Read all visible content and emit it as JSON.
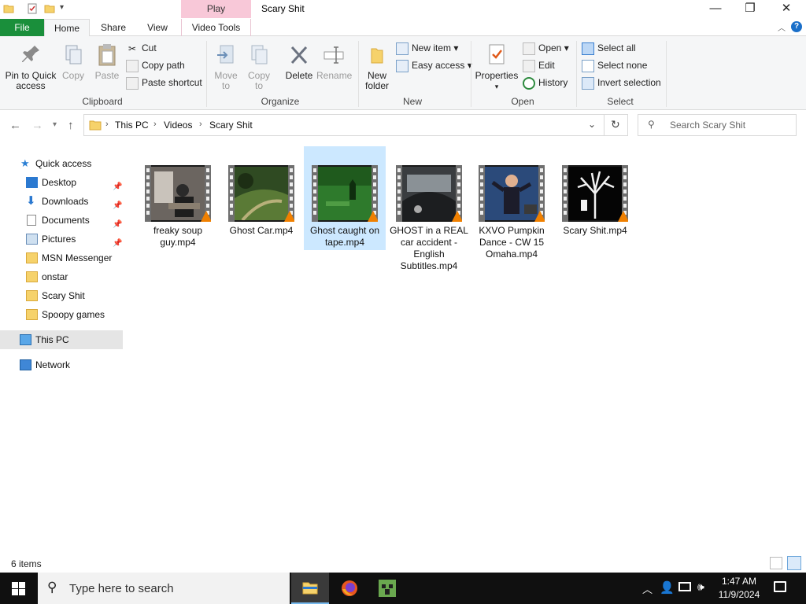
{
  "window": {
    "title": "Scary Shit",
    "contextual_tab": "Play"
  },
  "tabs": [
    "File",
    "Home",
    "Share",
    "View",
    "Video Tools"
  ],
  "ribbon": {
    "clipboard": {
      "label": "Clipboard",
      "pin": "Pin to Quick access",
      "copy": "Copy",
      "paste": "Paste",
      "cut": "Cut",
      "copy_path": "Copy path",
      "paste_shortcut": "Paste shortcut"
    },
    "organize": {
      "label": "Organize",
      "move_to": "Move to",
      "copy_to": "Copy to",
      "delete": "Delete",
      "rename": "Rename"
    },
    "new": {
      "label": "New",
      "new_folder": "New folder",
      "new_item": "New item",
      "easy_access": "Easy access"
    },
    "open": {
      "label": "Open",
      "properties": "Properties",
      "open": "Open",
      "edit": "Edit",
      "history": "History"
    },
    "select": {
      "label": "Select",
      "select_all": "Select all",
      "select_none": "Select none",
      "invert": "Invert selection"
    }
  },
  "address": {
    "crumbs": [
      "This PC",
      "Videos",
      "Scary Shit"
    ]
  },
  "search": {
    "placeholder": "Search Scary Shit"
  },
  "nav": {
    "quick_access": "Quick access",
    "items": [
      "Desktop",
      "Downloads",
      "Documents",
      "Pictures",
      "MSN Messenger",
      "onstar",
      "Scary Shit",
      "Spoopy games"
    ],
    "this_pc": "This PC",
    "network": "Network"
  },
  "files": [
    "freaky soup guy.mp4",
    "Ghost Car.mp4",
    "Ghost caught on tape.mp4",
    "GHOST in a REAL car accident - English Subtitles.mp4",
    "KXVO Pumpkin Dance - CW 15 Omaha.mp4",
    "Scary Shit.mp4"
  ],
  "status": {
    "count": "6 items"
  },
  "taskbar": {
    "search_placeholder": "Type here to search",
    "time": "1:47 AM",
    "date": "11/9/2024"
  },
  "colors": {
    "file_tab": "#1a8f3b",
    "context_tab": "#f8c8d8",
    "selection": "#cce8ff",
    "vlc": "#f08000"
  }
}
